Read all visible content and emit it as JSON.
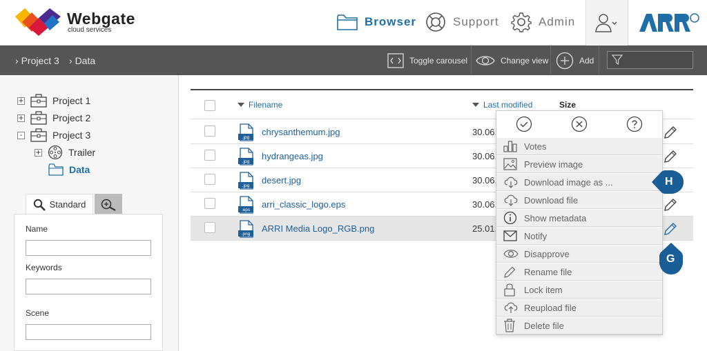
{
  "brand": {
    "name": "Webgate",
    "subtitle": "cloud services",
    "partner_logo": "ARRI"
  },
  "nav": {
    "browser": "Browser",
    "support": "Support",
    "admin": "Admin"
  },
  "breadcrumb": [
    "Project 3",
    "Data"
  ],
  "toolbar": {
    "toggle_carousel": "Toggle carousel",
    "change_view": "Change view",
    "add": "Add",
    "filter_placeholder": ""
  },
  "tree": [
    {
      "label": "Project 1",
      "toggle": "+"
    },
    {
      "label": "Project 2",
      "toggle": "+"
    },
    {
      "label": "Project 3",
      "toggle": "-"
    },
    {
      "label": "Trailer",
      "toggle": "+"
    },
    {
      "label": "Data",
      "toggle": ""
    }
  ],
  "search": {
    "tab_standard": "Standard",
    "name_label": "Name",
    "keywords_label": "Keywords",
    "scene_label": "Scene",
    "name_value": "",
    "keywords_value": "",
    "scene_value": ""
  },
  "table": {
    "col_filename": "Filename",
    "col_modified": "Last modified",
    "col_size": "Size",
    "rows": [
      {
        "name": "chrysanthemum.jpg",
        "ext": ".jpg",
        "date": "30.06."
      },
      {
        "name": "hydrangeas.jpg",
        "ext": ".jpg",
        "date": "30.06."
      },
      {
        "name": "desert.jpg",
        "ext": ".jpg",
        "date": "30.06."
      },
      {
        "name": "arri_classic_logo.eps",
        "ext": ".eps",
        "date": "30.06."
      },
      {
        "name": "ARRI Media Logo_RGB.png",
        "ext": ".png",
        "date": "25.01."
      }
    ]
  },
  "context_menu": {
    "items": [
      "Votes",
      "Preview image",
      "Download image as ...",
      "Download file",
      "Show metadata",
      "Notify",
      "Disapprove",
      "Rename file",
      "Lock item",
      "Reupload file",
      "Delete file"
    ]
  },
  "markers": {
    "h": "H",
    "g": "G"
  },
  "colors": {
    "accent": "#1e6fa8",
    "toolbar": "#555555",
    "marker": "#1a5e97"
  }
}
